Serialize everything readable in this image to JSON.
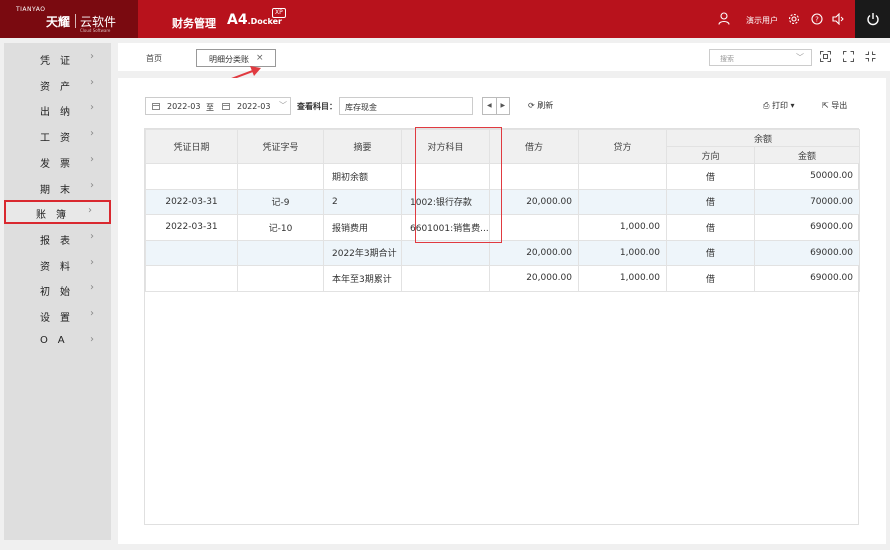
{
  "header": {
    "logo_small": "TIANYAO",
    "brand": "天耀",
    "cloud": "云软件",
    "brand_tagline": "Cloud Software",
    "title": "财务管理",
    "product": "A4",
    "product_suffix": ".Docker",
    "badge": "XP",
    "user": "演示用户"
  },
  "sidebar": {
    "items": [
      {
        "label": "凭证"
      },
      {
        "label": "资产"
      },
      {
        "label": "出纳"
      },
      {
        "label": "工资"
      },
      {
        "label": "发票"
      },
      {
        "label": "期末"
      },
      {
        "label": "账簿"
      },
      {
        "label": "报表"
      },
      {
        "label": "资料"
      },
      {
        "label": "初始"
      },
      {
        "label": "设置"
      },
      {
        "label": "OA"
      }
    ],
    "active_index": 6
  },
  "tabs": {
    "home": "首页",
    "active": "明细分类账",
    "close": "×",
    "search_placeholder": "搜索"
  },
  "toolbar": {
    "date_from": "2022-03",
    "date_sep": "至",
    "date_to": "2022-03",
    "subject_label": "查看科目：",
    "subject_value": "库存现金",
    "refresh": "刷新",
    "print": "打印",
    "export": "导出"
  },
  "table": {
    "headers": {
      "date": "凭证日期",
      "voucher": "凭证字号",
      "summary": "摘要",
      "counter": "对方科目",
      "debit": "借方",
      "credit": "贷方",
      "balance": "余额",
      "direction": "方向",
      "amount": "金额"
    },
    "rows": [
      {
        "date": "",
        "voucher": "",
        "summary": "期初余额",
        "counter": "",
        "debit": "",
        "credit": "",
        "direction": "借",
        "amount": "50000.00"
      },
      {
        "date": "2022-03-31",
        "voucher": "记-9",
        "summary": "2",
        "counter": "1002:银行存款",
        "debit": "20,000.00",
        "credit": "",
        "direction": "借",
        "amount": "70000.00"
      },
      {
        "date": "2022-03-31",
        "voucher": "记-10",
        "summary": "报销费用",
        "counter": "6601001:销售费...",
        "debit": "",
        "credit": "1,000.00",
        "direction": "借",
        "amount": "69000.00"
      },
      {
        "date": "",
        "voucher": "",
        "summary": "2022年3期合计",
        "counter": "",
        "debit": "20,000.00",
        "credit": "1,000.00",
        "direction": "借",
        "amount": "69000.00"
      },
      {
        "date": "",
        "voucher": "",
        "summary": "本年至3期累计",
        "counter": "",
        "debit": "20,000.00",
        "credit": "1,000.00",
        "direction": "借",
        "amount": "69000.00"
      }
    ]
  },
  "colors": {
    "brand_red": "#b8121c",
    "highlight": "#e03a40",
    "row_highlight": "#eef5fa"
  }
}
